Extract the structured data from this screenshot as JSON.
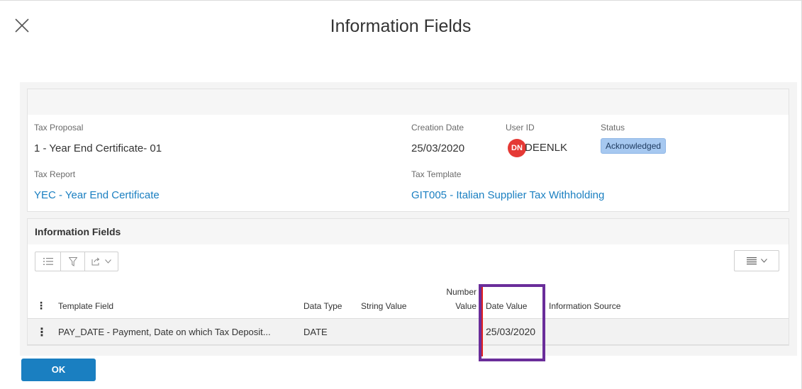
{
  "dialog": {
    "title": "Information Fields"
  },
  "header": {
    "tax_proposal": {
      "label": "Tax Proposal",
      "value": "1 - Year End Certificate- 01"
    },
    "creation_date": {
      "label": "Creation Date",
      "value": "25/03/2020"
    },
    "user_id": {
      "label": "User ID",
      "initials": "DN",
      "value": "DEENLK"
    },
    "status": {
      "label": "Status",
      "value": "Acknowledged"
    },
    "tax_report": {
      "label": "Tax Report",
      "value": "YEC - Year End Certificate"
    },
    "tax_template": {
      "label": "Tax Template",
      "value": "GIT005 - Italian Supplier Tax Withholding"
    }
  },
  "fields_table": {
    "title": "Information Fields",
    "toolbar_icons": [
      "list-icon",
      "filter-icon",
      "export-icon",
      "chevron-down-icon"
    ],
    "view_icons": [
      "view-lines-icon",
      "chevron-down-icon"
    ],
    "columns": {
      "template_field": "Template Field",
      "data_type": "Data Type",
      "string_value": "String Value",
      "number_value_line1": "Number",
      "number_value_line2": "Value",
      "date_value": "Date Value",
      "information_source": "Information Source"
    },
    "rows": [
      {
        "template_field": "PAY_DATE - Payment, Date on which Tax Deposit...",
        "data_type": "DATE",
        "string_value": "",
        "number_value": "",
        "date_value": "25/03/2020",
        "information_source": ""
      }
    ]
  },
  "footer": {
    "ok_label": "OK"
  },
  "colors": {
    "accent": "#1a7fc1",
    "status_badge": "#a6c8f0",
    "avatar": "#e53935",
    "highlight": "#6a2d9a",
    "marker": "#e02020"
  }
}
